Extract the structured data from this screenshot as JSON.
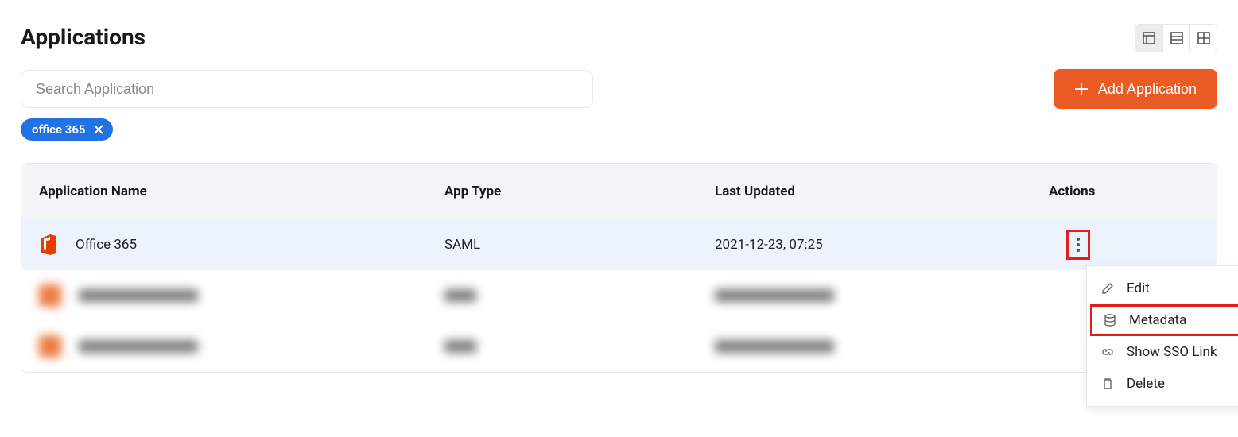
{
  "header": {
    "title": "Applications"
  },
  "search": {
    "placeholder": "Search Application"
  },
  "add_button_label": "Add Application",
  "filter_chip": {
    "label": "office 365"
  },
  "table": {
    "columns": {
      "name": "Application Name",
      "type": "App Type",
      "updated": "Last Updated",
      "actions": "Actions"
    },
    "rows": [
      {
        "name": "Office 365",
        "type": "SAML",
        "updated": "2021-12-23, 07:25"
      }
    ]
  },
  "menu": {
    "edit": "Edit",
    "metadata": "Metadata",
    "show_sso": "Show SSO Link",
    "delete": "Delete"
  }
}
